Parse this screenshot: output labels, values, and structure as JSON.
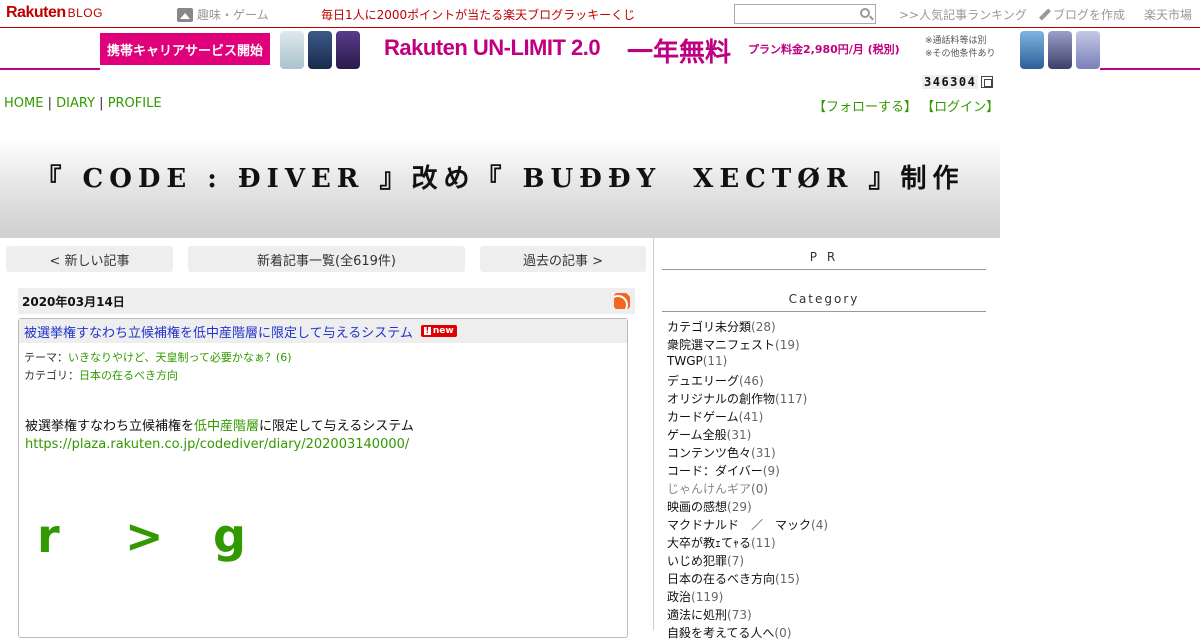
{
  "topbar": {
    "logo_main": "Rakuten",
    "logo_sub": "BLOG",
    "genre": "趣味・ゲーム",
    "lucky": "毎日1人に2000ポイントが当たる楽天ブログラッキーくじ",
    "search_value": "",
    "ranking": ">>人気記事ランキング",
    "create": "ブログを作成",
    "market": "楽天市場"
  },
  "ad": {
    "pill": "携帯キャリアサービス開始",
    "brand": "Rakuten UN-LIMIT 2.0",
    "free": "一年無料",
    "price": "プラン料金2,980円/月 (税別)",
    "note1": "※通話料等は別",
    "note2": "※その他条件あり"
  },
  "counter": "346304",
  "blognav": {
    "home": "HOME",
    "diary": "DIARY",
    "profile": "PROFILE",
    "sep": "|"
  },
  "usernav": {
    "follow": "【フォローする】",
    "login": "【ログイン】"
  },
  "blog_title": "『 CODE : ĐIVER 』改め『 BUĐĐY　XECTØR 』制作",
  "pager": {
    "prev": "< 新しい記事",
    "list": "新着記事一覧(全619件)",
    "next": "過去の記事 >"
  },
  "entry": {
    "date": "2020年03月14日",
    "title": "被選挙権すなわち立候補権を低中産階層に限定して与えるシステム",
    "new_badge": "new",
    "theme_label": "テーマ：",
    "theme": "いきなりやけど、天皇制って必要かなぁ？(6)",
    "category_label": "カテゴリ：",
    "category": "日本の在るべき方向",
    "body_pre": "被選挙権すなわち立候補権を",
    "body_link": "低中産階層",
    "body_post": "に限定して与えるシステム",
    "url": "https://plaza.rakuten.co.jp/codediver/diary/202003140000/",
    "big_chars": [
      "r",
      ">",
      "g"
    ]
  },
  "sidebar": {
    "pr": "P R",
    "category_title": "Category",
    "categories": [
      {
        "name": "カテゴリ未分類",
        "count": "(28)"
      },
      {
        "name": "衆院選マニフェスト",
        "count": "(19)"
      },
      {
        "name": "TWGP",
        "count": "(11)"
      },
      {
        "name": "デュエリーグ",
        "count": "(46)"
      },
      {
        "name": "オリジナルの創作物",
        "count": "(117)"
      },
      {
        "name": "カードゲーム",
        "count": "(41)"
      },
      {
        "name": "ゲーム全般",
        "count": "(31)"
      },
      {
        "name": "コンテンツ色々",
        "count": "(31)"
      },
      {
        "name": "コード：ダイバー",
        "count": "(9)"
      },
      {
        "name": "じゃんけんギア",
        "count": "(0)"
      },
      {
        "name": "映画の感想",
        "count": "(29)"
      },
      {
        "name": "マクドナルド　／　マック",
        "count": "(4)"
      },
      {
        "name": "大卒が教ｪてｬる",
        "count": "(11)"
      },
      {
        "name": "いじめ犯罪",
        "count": "(7)"
      },
      {
        "name": "日本の在るべき方向",
        "count": "(15)"
      },
      {
        "name": "政治",
        "count": "(119)"
      },
      {
        "name": "適法に処刑",
        "count": "(73)"
      },
      {
        "name": "自殺を考えてる人へ",
        "count": "(0)"
      }
    ]
  },
  "colors": {
    "rakuten_red": "#bf0000",
    "link_green": "#339900",
    "title_blue": "#2233cc",
    "ad_magenta": "#e0007a"
  }
}
